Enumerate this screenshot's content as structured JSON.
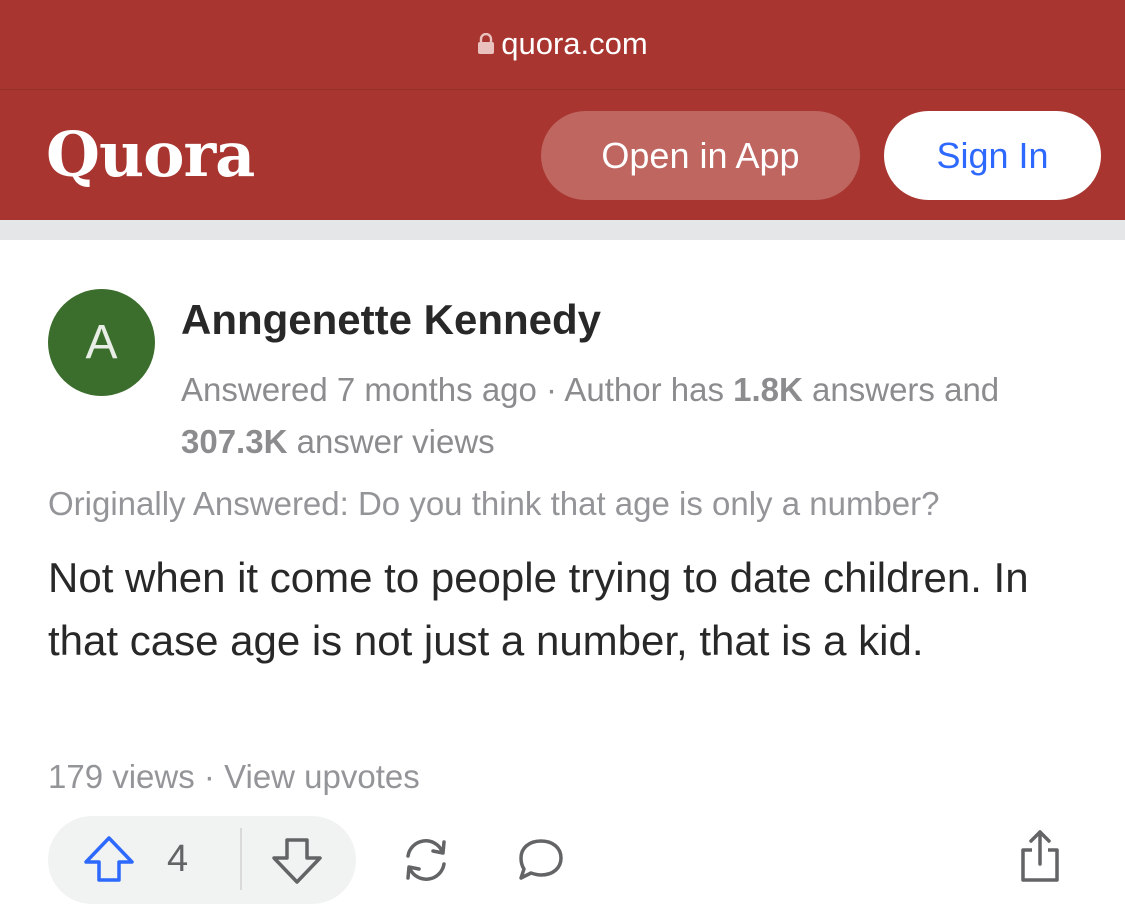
{
  "browser": {
    "url": "quora.com",
    "lock_icon": "lock-icon"
  },
  "header": {
    "logo": "Quora",
    "open_in_app": "Open in App",
    "sign_in": "Sign In",
    "background_color": "#a8352f",
    "sign_in_color": "#2e69ff"
  },
  "answer": {
    "avatar_letter": "A",
    "avatar_color": "#3b6e2c",
    "author": "Anngenette Kennedy",
    "meta_prefix": "Answered 7 months ago · Author has ",
    "answers_count": "1.8K",
    "meta_middle": " answers and ",
    "views_count": "307.3K",
    "meta_suffix": " answer views",
    "originally_answered": "Originally Answered: Do you think that age is only a number?",
    "text": "Not when it come to people trying to date children. In that case age is not just a number, that is a kid.",
    "views": "179 views",
    "separator": " · ",
    "view_upvotes": "View upvotes"
  },
  "actions": {
    "upvote_icon": "upvote-arrow-icon",
    "upvote_count": "4",
    "downvote_icon": "downvote-arrow-icon",
    "reshare_icon": "reshare-icon",
    "comment_icon": "comment-bubble-icon",
    "share_icon": "share-icon"
  }
}
